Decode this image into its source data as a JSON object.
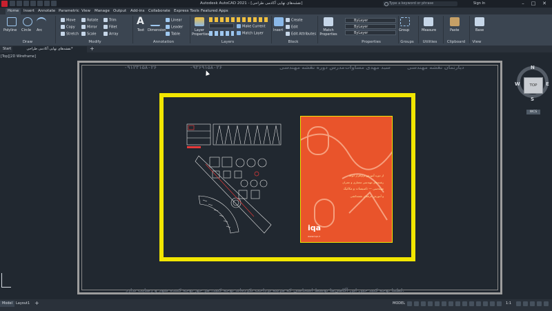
{
  "app": {
    "title": "Autodesk AutoCAD 2021 - [نقشه‌های نهایی آکادمی طراحی]",
    "search_placeholder": "Type a keyword or phrase",
    "signin": "Sign In"
  },
  "ribbon_tabs": [
    "Home",
    "Insert",
    "Annotate",
    "Parametric",
    "View",
    "Manage",
    "Output",
    "Add-ins",
    "Collaborate",
    "Express Tools",
    "Featured Apps"
  ],
  "active_tab": "Home",
  "ribbon": {
    "draw": {
      "polyline": "Polyline",
      "circle": "Circle",
      "arc": "Arc",
      "label": "Draw"
    },
    "modify": {
      "move": "Move",
      "rotate": "Rotate",
      "trim": "Trim",
      "copy": "Copy",
      "mirror": "Mirror",
      "fillet": "Fillet",
      "stretch": "Stretch",
      "scale": "Scale",
      "array": "Array",
      "label": "Modify"
    },
    "annotation": {
      "text": "Text",
      "dimension": "Dimension",
      "linear": "Linear",
      "leader": "Leader",
      "table": "Table",
      "label": "Annotation"
    },
    "layers": {
      "layer_properties": "Layer Properties",
      "make_current": "Make Current",
      "match_layer": "Match Layer",
      "label": "Layers"
    },
    "block": {
      "insert": "Insert",
      "create": "Create",
      "edit": "Edit",
      "edit_attributes": "Edit Attributes",
      "label": "Block"
    },
    "properties": {
      "match_properties": "Match Properties",
      "bylayer1": "ByLayer",
      "bylayer2": "ByLayer",
      "bylayer3": "ByLayer",
      "label": "Properties"
    },
    "groups": {
      "group": "Group",
      "label": "Groups"
    },
    "utilities": {
      "measure": "Measure",
      "label": "Utilities"
    },
    "clipboard": {
      "paste": "Paste",
      "label": "Clipboard"
    },
    "view": {
      "base": "Base",
      "label": "View"
    }
  },
  "file_tabs": {
    "start": "Start",
    "drawing": "نقشه‌های نهایی آکادمی طراحی*"
  },
  "viewport_label": "[Top][2D Wireframe]",
  "viewcube": {
    "face": "TOP",
    "n": "N",
    "s": "S",
    "e": "E",
    "w": "W",
    "wcs": "WCS"
  },
  "frame": {
    "top_right": "دپارتمان نقشه مهندسی",
    "top_mid1": "سید مهدی مساوات",
    "top_mid2": "مدرس دوره نقشه مهندسی",
    "top_phone1": "۰۹۳۶۹۱۵۸۰۲۶",
    "top_phone2": "۰۹۱۲۳۱۵۸۰۲۶",
    "bottom": "لطفا توجه کنید حین این آگاهی‌ها توسط اشخاصی که هزینه پرداخت نکرده‌اند توجه کنید. هر حق توجه کننده شود و رضایت ندارد."
  },
  "book": {
    "line1": "از دوره آموزش نرم‌افزار اتوکد",
    "line2": "رشته‌های مهندسی معماری و عمران",
    "line3": "مهندسی — تاسیسات و مکانیک",
    "line4": "و آموزش حرفه‌ای نقشه‌کشی",
    "logo": "iqa",
    "footer": "www.iqa.ir"
  },
  "status": {
    "model": "Model",
    "layout1": "Layout1",
    "model_btn": "MODEL",
    "scale": "1:1"
  },
  "colors": {
    "accent": "#1a8fe8",
    "frame_yellow": "#f2e600",
    "book_orange": "#e9542b"
  }
}
